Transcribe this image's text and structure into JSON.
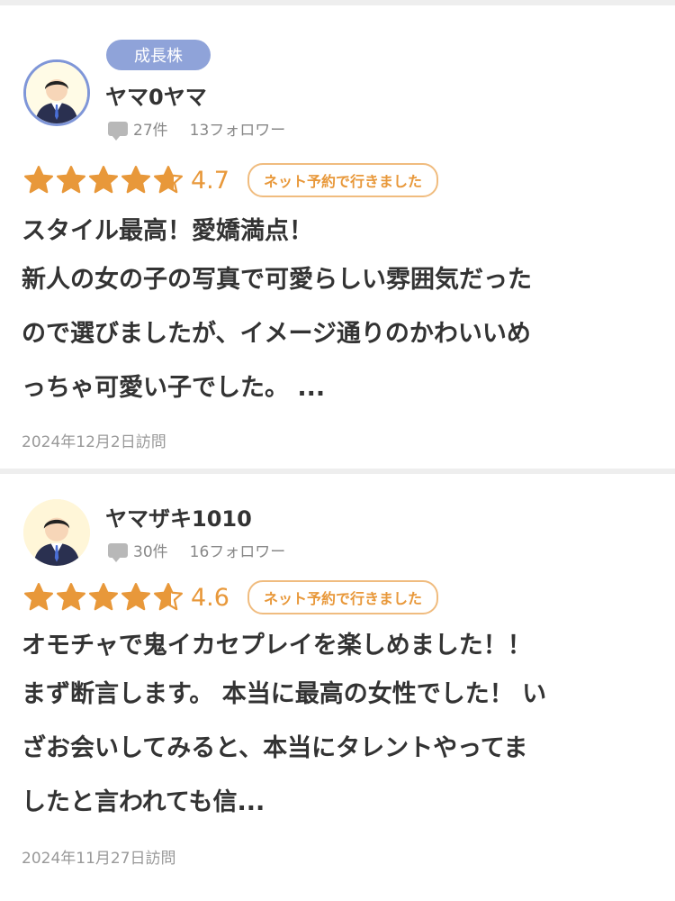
{
  "reviews": [
    {
      "badge": "成長株",
      "name": "ヤマ0ヤマ",
      "posts": "27件",
      "followers": "13フォロワー",
      "rating": 4.7,
      "score_text": "4.7",
      "tag": "ネット予約で行きました",
      "title": "スタイル最高！愛嬌満点！",
      "body_lines": [
        "新人の女の子の写真で可愛らしい雰囲気だった",
        "ので選びましたが、イメージ通りのかわいいめ",
        "っちゃ可愛い子でした。 ..."
      ],
      "date": "2024年12月2日訪問"
    },
    {
      "name": "ヤマザキ1010",
      "posts": "30件",
      "followers": "16フォロワー",
      "rating": 4.6,
      "score_text": "4.6",
      "tag": "ネット予約で行きました",
      "title": "オモチャで鬼イカセプレイを楽しめました！！",
      "body_lines": [
        "まず断言します。 本当に最高の女性でした！ い",
        "ざお会いしてみると、本当にタレントやってま",
        "したと言われても信..."
      ],
      "date": "2024年11月27日訪問"
    }
  ],
  "colors": {
    "star": "#e8983a",
    "badge": "#8fa3d9",
    "tag_border": "#f0bc7f"
  },
  "icons": {
    "comment": "chat-bubble-icon",
    "star": "star-icon"
  }
}
